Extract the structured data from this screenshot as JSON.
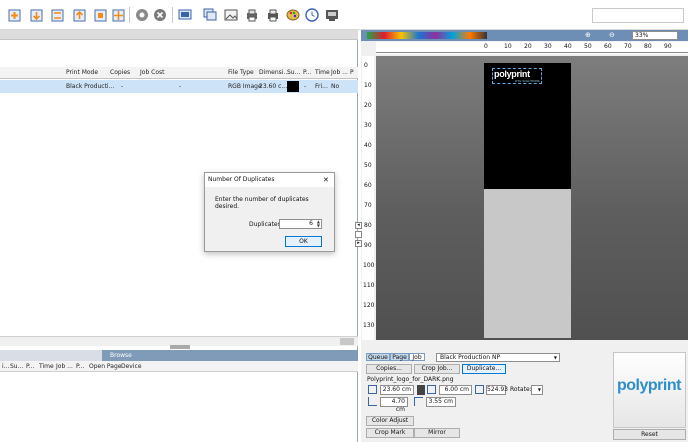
{
  "toolbar": {
    "icons": [
      "queue-add-icon",
      "print-icon",
      "split-icon",
      "sheet-icon",
      "duplicate-icon",
      "settings-icon",
      "cancel-icon",
      "screen-icon",
      "layers-icon",
      "image-icon",
      "printer-icon",
      "printer2-icon",
      "palette-icon",
      "clock-icon",
      "export-icon"
    ]
  },
  "job_table": {
    "columns": [
      "Print Mode",
      "Copies",
      "Job Cost",
      "File Type",
      "Dimensi...",
      "Su...",
      "P...",
      "Time",
      "Job ...",
      "P"
    ],
    "row": {
      "print_mode": "Black Producti...",
      "copies": "-",
      "job_cost": "-",
      "file_type": "RGB Image",
      "dimensions": "23.60 c...",
      "p": "-",
      "time": "Fri...",
      "job": "No"
    }
  },
  "browse": {
    "label": "Browse",
    "columns": [
      "i...",
      "Su...",
      "P...",
      "Time",
      "Job ...",
      "P...",
      "Open Page",
      "Device"
    ]
  },
  "dialog": {
    "title": "Number Of Duplicates",
    "close": "✕",
    "message": "Enter the number of duplicates desired.",
    "field_label": "Duplicates:",
    "value": "6",
    "ok": "OK"
  },
  "preview": {
    "zoom": "33%",
    "ruler_top": [
      "0",
      "10",
      "20",
      "30",
      "40",
      "50",
      "60",
      "70",
      "80",
      "90"
    ],
    "ruler_left": [
      "0",
      "10",
      "20",
      "30",
      "40",
      "50",
      "60",
      "70",
      "80",
      "90",
      "100",
      "110",
      "120",
      "130"
    ],
    "logo_text": "polyprint",
    "logo_tag": "DTG SOLUTIONS"
  },
  "job_panel": {
    "tabs": [
      "Queue",
      "Page",
      "Job"
    ],
    "print_mode": "Black Production NP",
    "buttons": {
      "copies": "Copies...",
      "crop": "Crop Job...",
      "duplicate": "Duplicate..."
    },
    "file_name": "Polyprint_logo_for_DARK.png",
    "width": "23.60 cm",
    "height": "6.00 cm",
    "dpi": "524.93",
    "rotate_label": "Rotate:",
    "x_offset": "4.70 cm",
    "y_offset": "3.55 cm",
    "bottom_tabs": {
      "color": "Color Adjust",
      "crop": "Crop Mark",
      "mirror": "Mirror"
    }
  },
  "thumb": {
    "logo": "polyprint",
    "reset": "Reset"
  },
  "colors": {
    "accent": "#0078d7",
    "canvas": "#5e5e5e",
    "selection": "#cde3f7",
    "header_blue": "#7f9bb8"
  }
}
